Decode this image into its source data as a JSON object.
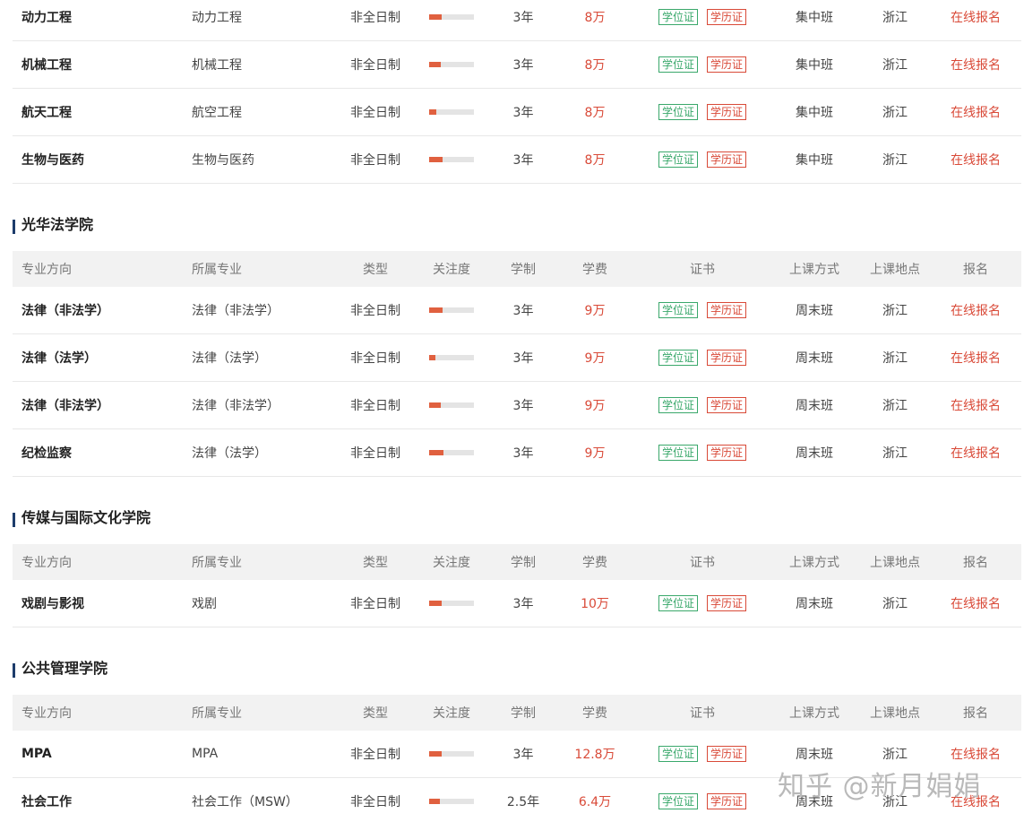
{
  "headers": [
    "专业方向",
    "所属专业",
    "类型",
    "关注度",
    "学制",
    "学费",
    "证书",
    "上课方式",
    "上课地点",
    "报名"
  ],
  "cert_labels": {
    "degree": "学位证",
    "education": "学历证"
  },
  "colors": {
    "accent": "#d94a38",
    "degree_green": "#3aa86b",
    "bar_fill": "#e0603f",
    "title_mark": "#1d3c6b"
  },
  "sections": [
    {
      "title": "",
      "show_header": false,
      "rows": [
        {
          "direction": "动力工程",
          "major": "动力工程",
          "type": "非全日制",
          "attention": 0.28,
          "duration": "3年",
          "fee": "8万",
          "mode": "集中班",
          "location": "浙江",
          "register": "在线报名"
        },
        {
          "direction": "机械工程",
          "major": "机械工程",
          "type": "非全日制",
          "attention": 0.26,
          "duration": "3年",
          "fee": "8万",
          "mode": "集中班",
          "location": "浙江",
          "register": "在线报名"
        },
        {
          "direction": "航天工程",
          "major": "航空工程",
          "type": "非全日制",
          "attention": 0.16,
          "duration": "3年",
          "fee": "8万",
          "mode": "集中班",
          "location": "浙江",
          "register": "在线报名"
        },
        {
          "direction": "生物与医药",
          "major": "生物与医药",
          "type": "非全日制",
          "attention": 0.3,
          "duration": "3年",
          "fee": "8万",
          "mode": "集中班",
          "location": "浙江",
          "register": "在线报名"
        }
      ]
    },
    {
      "title": "光华法学院",
      "show_header": true,
      "rows": [
        {
          "direction": "法律（非法学）",
          "major": "法律（非法学）",
          "type": "非全日制",
          "attention": 0.3,
          "duration": "3年",
          "fee": "9万",
          "mode": "周末班",
          "location": "浙江",
          "register": "在线报名"
        },
        {
          "direction": "法律（法学）",
          "major": "法律（法学）",
          "type": "非全日制",
          "attention": 0.14,
          "duration": "3年",
          "fee": "9万",
          "mode": "周末班",
          "location": "浙江",
          "register": "在线报名"
        },
        {
          "direction": "法律（非法学）",
          "major": "法律（非法学）",
          "type": "非全日制",
          "attention": 0.26,
          "duration": "3年",
          "fee": "9万",
          "mode": "周末班",
          "location": "浙江",
          "register": "在线报名"
        },
        {
          "direction": "纪检监察",
          "major": "法律（法学）",
          "type": "非全日制",
          "attention": 0.32,
          "duration": "3年",
          "fee": "9万",
          "mode": "周末班",
          "location": "浙江",
          "register": "在线报名"
        }
      ]
    },
    {
      "title": "传媒与国际文化学院",
      "show_header": true,
      "rows": [
        {
          "direction": "戏剧与影视",
          "major": "戏剧",
          "type": "非全日制",
          "attention": 0.28,
          "duration": "3年",
          "fee": "10万",
          "mode": "周末班",
          "location": "浙江",
          "register": "在线报名"
        }
      ]
    },
    {
      "title": "公共管理学院",
      "show_header": true,
      "rows": [
        {
          "direction": "MPA",
          "major": "MPA",
          "type": "非全日制",
          "attention": 0.28,
          "duration": "3年",
          "fee": "12.8万",
          "mode": "周末班",
          "location": "浙江",
          "register": "在线报名"
        },
        {
          "direction": "社会工作",
          "major": "社会工作（MSW）",
          "type": "非全日制",
          "attention": 0.24,
          "duration": "2.5年",
          "fee": "6.4万",
          "mode": "周末班",
          "location": "浙江",
          "register": "在线报名"
        }
      ]
    }
  ],
  "watermark": "知乎 @新月娟娟"
}
